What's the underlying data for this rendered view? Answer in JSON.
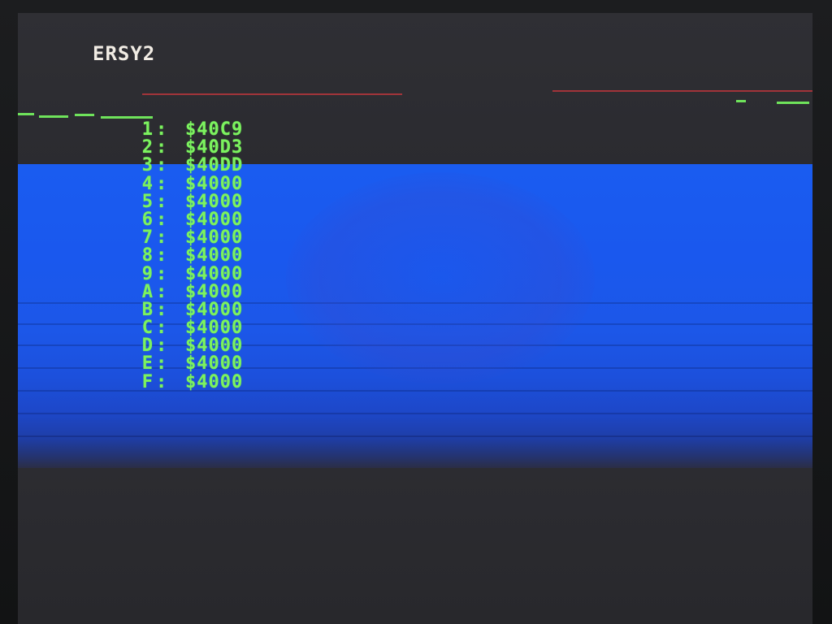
{
  "screen": {
    "title": "ERSY2",
    "colors": {
      "text_green": "#7cf25f",
      "title_white": "#f1ece4",
      "background_blue": "#1a5cf0",
      "background_dark": "#2b2b30",
      "line_red": "#a2343a"
    }
  },
  "table": {
    "separator": ":",
    "rows": [
      {
        "index": "1",
        "address": "$40C9"
      },
      {
        "index": "2",
        "address": "$40D3"
      },
      {
        "index": "3",
        "address": "$40DD"
      },
      {
        "index": "4",
        "address": "$4000"
      },
      {
        "index": "5",
        "address": "$4000"
      },
      {
        "index": "6",
        "address": "$4000"
      },
      {
        "index": "7",
        "address": "$4000"
      },
      {
        "index": "8",
        "address": "$4000"
      },
      {
        "index": "9",
        "address": "$4000"
      },
      {
        "index": "A",
        "address": "$4000"
      },
      {
        "index": "B",
        "address": "$4000"
      },
      {
        "index": "C",
        "address": "$4000"
      },
      {
        "index": "D",
        "address": "$4000"
      },
      {
        "index": "E",
        "address": "$4000"
      },
      {
        "index": "F",
        "address": "$4000"
      }
    ]
  }
}
